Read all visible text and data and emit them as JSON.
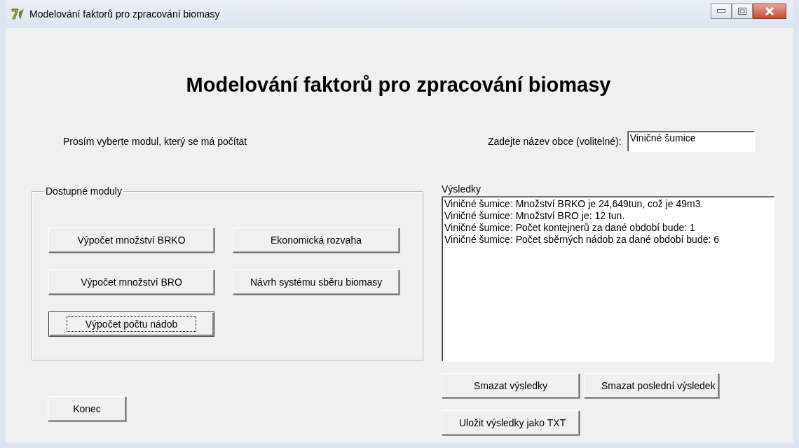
{
  "window": {
    "title": "Modelování faktorů pro zpracování biomasy"
  },
  "heading": "Modelování faktorů pro zpracování biomasy",
  "prompt": "Prosím vyberte modul, který se má počítat",
  "town": {
    "label": "Zadejte název obce (volitelné):",
    "value": "Viničné šumice"
  },
  "modules": {
    "title": "Dostupné moduly",
    "buttons": [
      {
        "label": "Výpočet množství BRKO",
        "focused": false
      },
      {
        "label": "Ekonomická rozvaha",
        "focused": false
      },
      {
        "label": "Výpočet množství BRO",
        "focused": false
      },
      {
        "label": "Návrh systému sběru biomasy",
        "focused": false
      },
      {
        "label": "Výpočet počtu nádob",
        "focused": true
      }
    ]
  },
  "results": {
    "label": "Výsledky",
    "lines": [
      "Viničné šumice: Množství BRKO je 24,649tun, což je 49m3.",
      "Viničné šumice: Množství BRO je: 12 tun.",
      "Viničné šumice: Počet kontejnerů za dané období bude: 1",
      "Viničné šumice: Počet sběrných nádob za dané období bude: 6"
    ]
  },
  "result_buttons": [
    "Smazat výsledky",
    "Smazat poslední výsledek",
    "Uložit výsledky jako TXT"
  ],
  "exit_button": "Konec"
}
